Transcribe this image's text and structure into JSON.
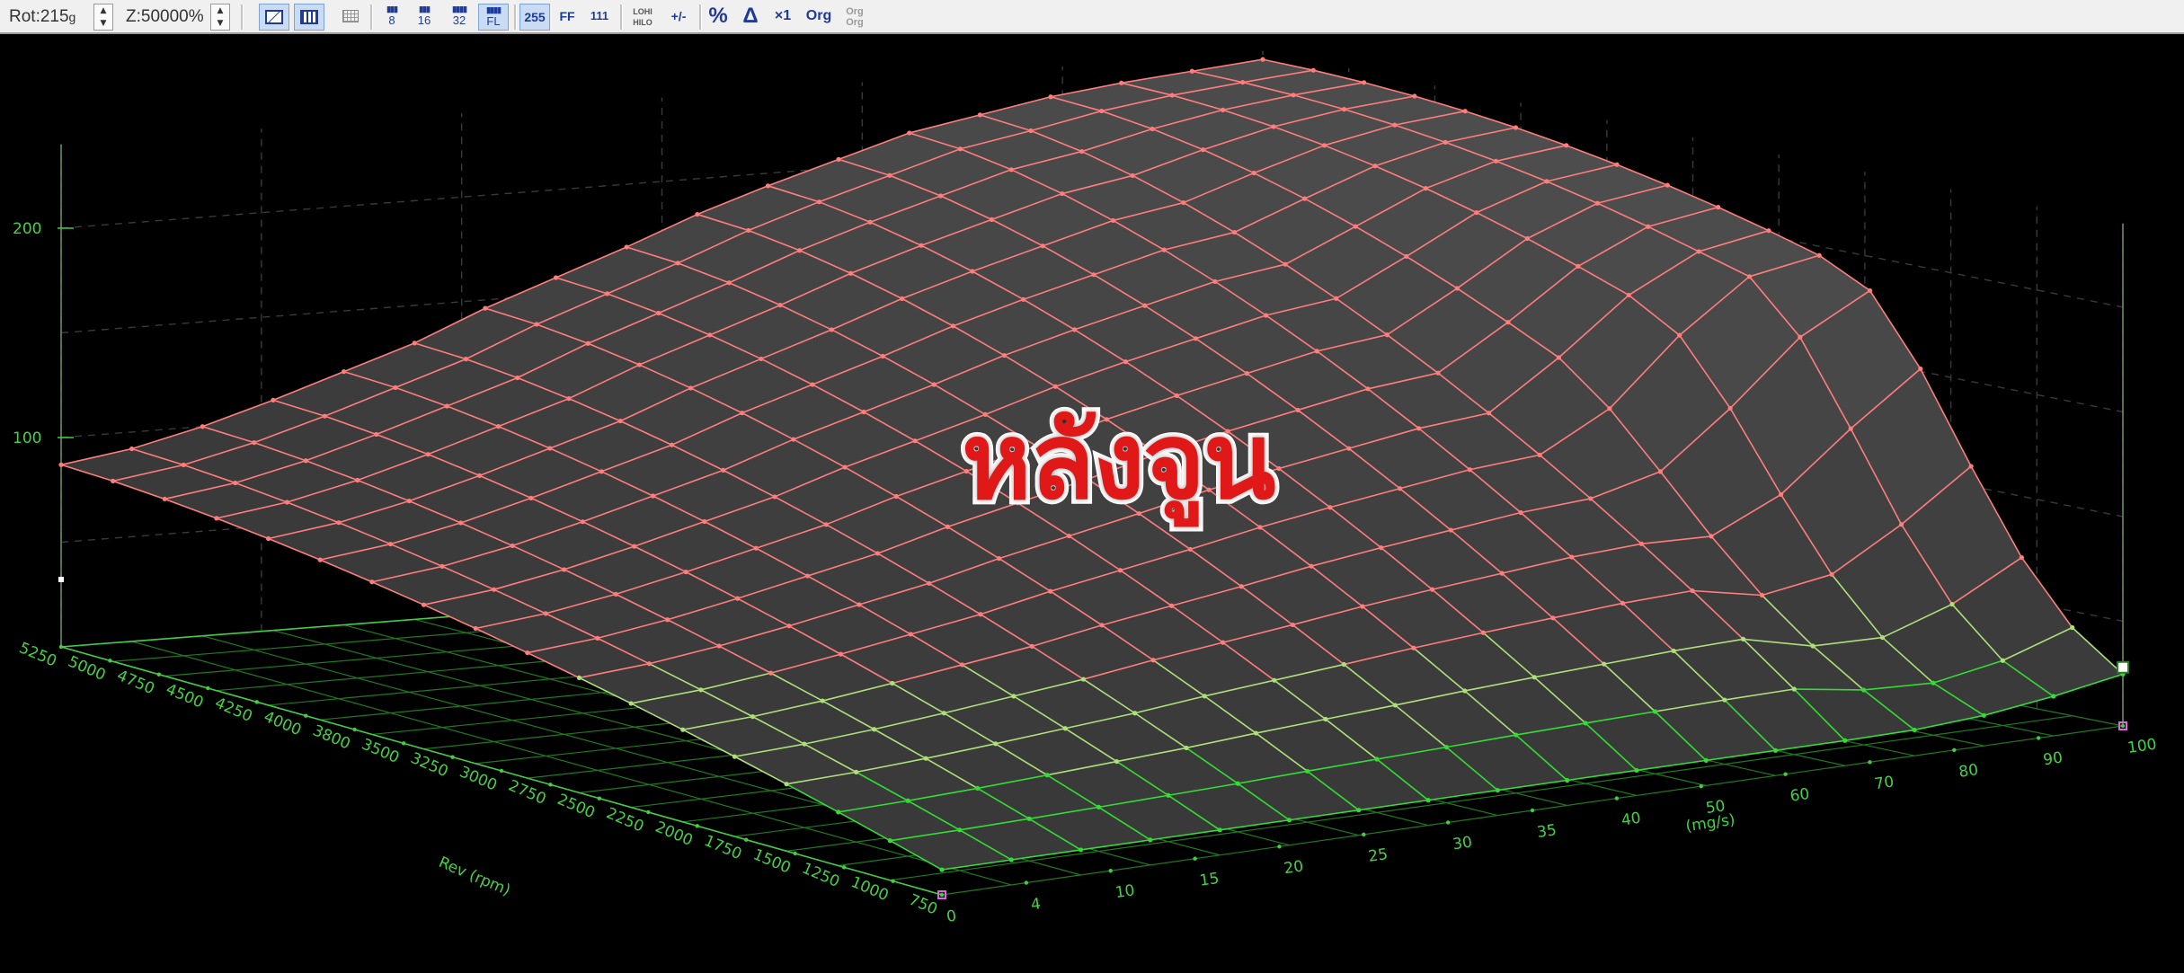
{
  "toolbar": {
    "rot_label": "Rot:215",
    "rot_unit": "g",
    "zoom_label": "Z:50000%",
    "buttons": [
      {
        "name": "view-mode-1-button",
        "label": "",
        "active": true
      },
      {
        "name": "view-mode-2-button",
        "label": "",
        "active": true
      },
      {
        "name": "grid-toggle-button",
        "label": "",
        "active": false
      },
      {
        "name": "bits-8-button",
        "label": "8",
        "active": false
      },
      {
        "name": "bits-16-button",
        "label": "16",
        "active": false
      },
      {
        "name": "bits-32-button",
        "label": "32",
        "active": false
      },
      {
        "name": "float-button",
        "label": "FL",
        "active": true
      },
      {
        "name": "decimal-255-button",
        "label": "255",
        "active": true
      },
      {
        "name": "hex-ff-button",
        "label": "FF",
        "active": false
      },
      {
        "name": "binary-111-button",
        "label": "111",
        "active": false
      },
      {
        "name": "lohi-hilo-button",
        "label": "LOHI HILO",
        "active": false
      },
      {
        "name": "sign-button",
        "label": "+/-",
        "active": false
      },
      {
        "name": "percent-button",
        "label": "%",
        "active": false
      },
      {
        "name": "delta-button",
        "label": "Δ",
        "active": false
      },
      {
        "name": "multiply-button",
        "label": "×1",
        "active": false
      },
      {
        "name": "original-button",
        "label": "Org",
        "active": false
      },
      {
        "name": "original-compare-button",
        "label": "Org Org",
        "active": false
      }
    ]
  },
  "overlay_title": "หลังจูน",
  "chart_data": {
    "type": "surface",
    "title": "",
    "xlabel": "Rev (rpm)",
    "ylabel": "(mg/s)",
    "zlabel": "",
    "zlim": [
      0,
      240
    ],
    "z_ticks": [
      "100",
      "200"
    ],
    "rpm_ticks": [
      "750",
      "1000",
      "1250",
      "1500",
      "1750",
      "2000",
      "2250",
      "2500",
      "2750",
      "3000",
      "3250",
      "3500",
      "3800",
      "4000",
      "4250",
      "4500",
      "4750",
      "5000",
      "5250"
    ],
    "load_ticks": [
      "0",
      "4",
      "10",
      "15",
      "20",
      "25",
      "30",
      "35",
      "40",
      "50",
      "60",
      "70",
      "80",
      "90",
      "100"
    ],
    "front_ridge_z": [
      87,
      92,
      100,
      110,
      121,
      132,
      146,
      158,
      170,
      183,
      194,
      204,
      214,
      220,
      226,
      230,
      233,
      236
    ],
    "fuel_cut_rpm_index": 13,
    "grid": true
  }
}
